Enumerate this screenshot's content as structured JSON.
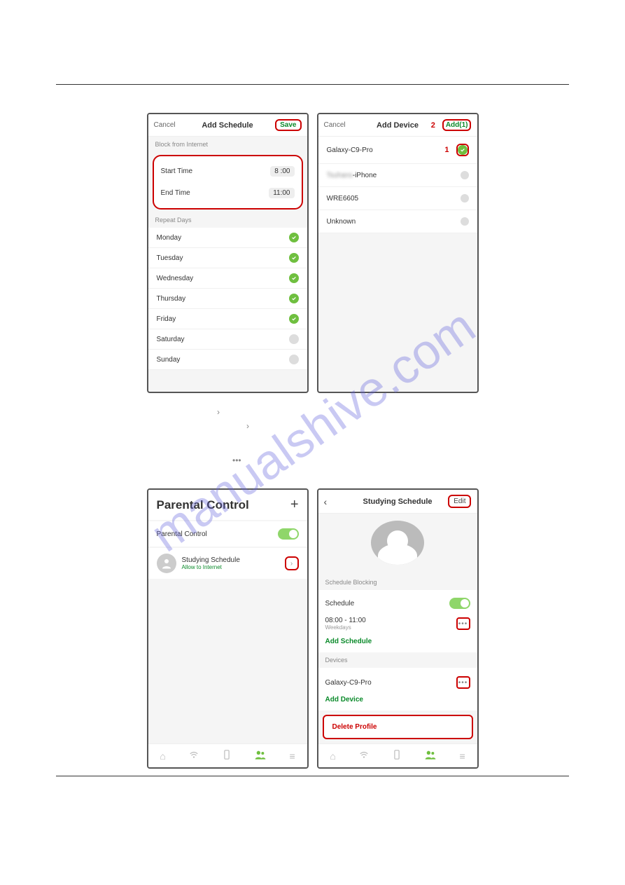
{
  "watermark": "manualshive.com",
  "screen1": {
    "cancel": "Cancel",
    "title": "Add Schedule",
    "save": "Save",
    "section1": "Block from Internet",
    "start_label": "Start Time",
    "start_val": "8  :00",
    "end_label": "End Time",
    "end_val": "11:00",
    "section2": "Repeat Days",
    "days": [
      {
        "name": "Monday",
        "on": true
      },
      {
        "name": "Tuesday",
        "on": true
      },
      {
        "name": "Wednesday",
        "on": true
      },
      {
        "name": "Thursday",
        "on": true
      },
      {
        "name": "Friday",
        "on": true
      },
      {
        "name": "Saturday",
        "on": false
      },
      {
        "name": "Sunday",
        "on": false
      }
    ]
  },
  "screen2": {
    "cancel": "Cancel",
    "title": "Add Device",
    "annot": "2",
    "add": "Add(1)",
    "devices": [
      {
        "name": "Galaxy-C9-Pro",
        "annot": "1",
        "selected": true
      },
      {
        "name": "Tsuhans-iPhone",
        "blur": true,
        "selected": false
      },
      {
        "name": "WRE6605",
        "selected": false
      },
      {
        "name": "Unknown",
        "selected": false
      }
    ]
  },
  "screen3": {
    "title": "Parental Control",
    "label": "Parental Control",
    "profile_name": "Studying  Schedule",
    "profile_sub": "Allow to Internet"
  },
  "screen4": {
    "title": "Studying Schedule",
    "edit": "Edit",
    "section1": "Schedule Blocking",
    "schedule_label": "Schedule",
    "time": "08:00 - 11:00",
    "time_sub": "Weekdays",
    "add_schedule": "Add Schedule",
    "section2": "Devices",
    "device": "Galaxy-C9-Pro",
    "add_device": "Add Device",
    "delete": "Delete Profile"
  }
}
